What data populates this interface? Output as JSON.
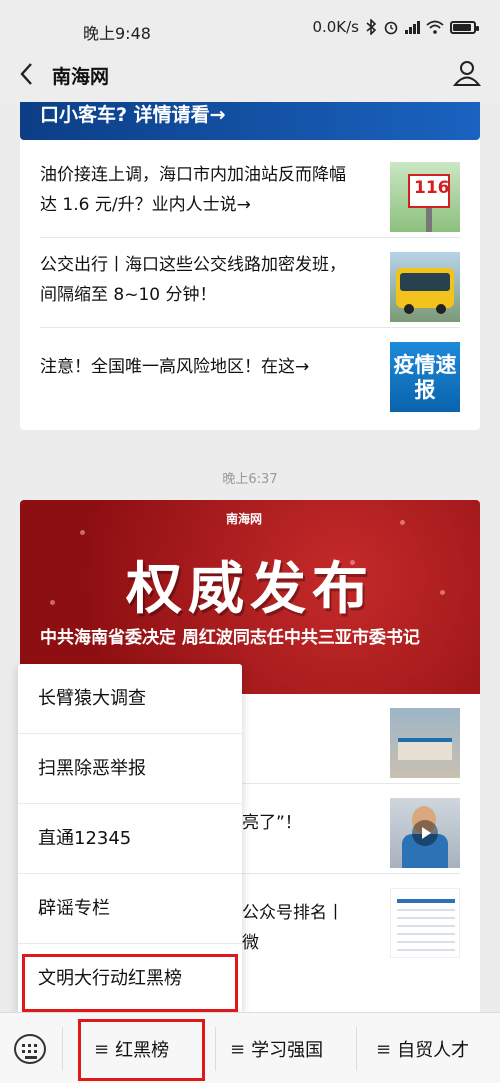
{
  "status_bar": {
    "time": "晚上9:48",
    "net_speed": "0.0K/s"
  },
  "nav": {
    "title": "南海网"
  },
  "card1": {
    "banner_text": "口小客车? 详情请看→",
    "items": [
      {
        "text": "油价接连上调，海口市内加油站反而降幅达 1.6 元/升？业内人士说→",
        "thumb_label": "116"
      },
      {
        "text": "公交出行丨海口这些公交线路加密发班，间隔缩至 8~10 分钟！"
      },
      {
        "text": "注意！全国唯一高风险地区！在这→",
        "thumb_label": "疫情速报"
      }
    ]
  },
  "timestamp": "晚上6:37",
  "card2": {
    "logo": "南海网",
    "hero_title": "权威发布",
    "hero_caption": "中共海南省委决定 周红波同志任中共三亚市委书记",
    "items": [
      {
        "text": ""
      },
      {
        "text": "亮了”！"
      },
      {
        "text": "公众号排名丨微"
      }
    ]
  },
  "menu": {
    "items": [
      {
        "label": "长臂猿大调查"
      },
      {
        "label": "扫黑除恶举报"
      },
      {
        "label": "直通12345"
      },
      {
        "label": "辟谣专栏"
      },
      {
        "label": "文明大行动红黑榜"
      }
    ]
  },
  "bottom_bar": {
    "tabs": [
      {
        "label": "红黑榜"
      },
      {
        "label": "学习强国"
      },
      {
        "label": "自贸人才"
      }
    ],
    "menu_glyph": "≡"
  },
  "colors": {
    "highlight": "#e0181a",
    "banner_blue": "#0c3e86",
    "hero_red": "#a8181b"
  }
}
